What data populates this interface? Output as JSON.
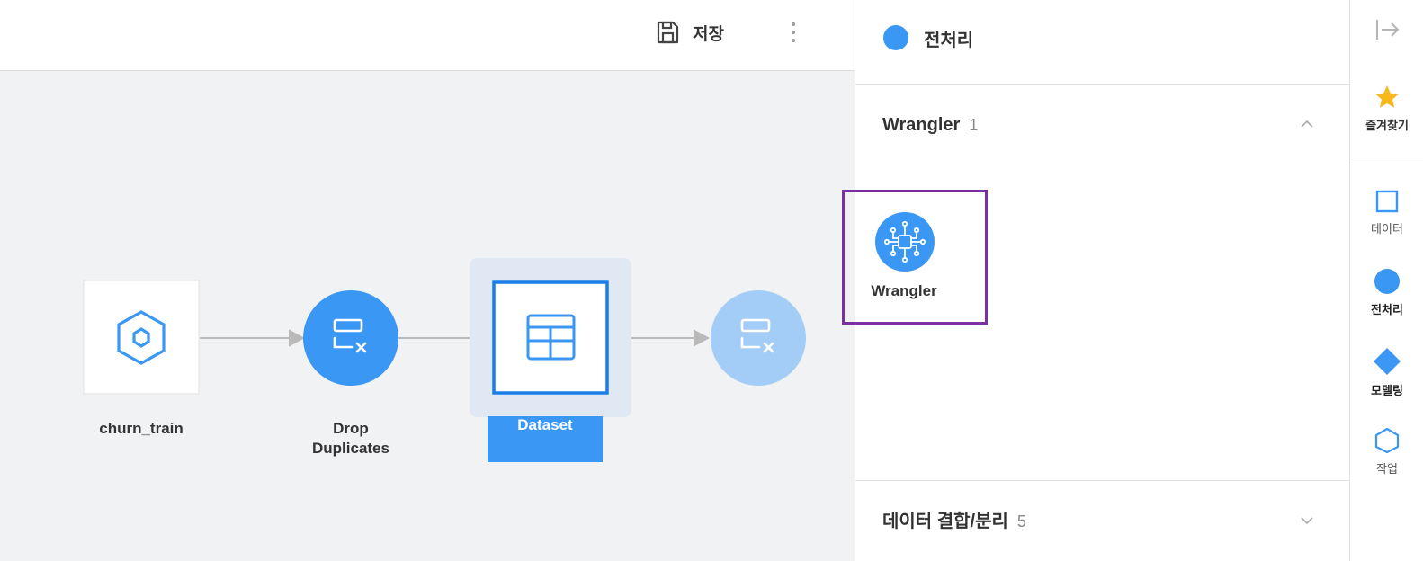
{
  "toolbar": {
    "save_label": "저장"
  },
  "workflow": {
    "nodes": [
      {
        "label": "churn_train",
        "icon": "hexagon-icon",
        "kind": "data"
      },
      {
        "label": "Drop\nDuplicates",
        "icon": "remove-duplicates-icon",
        "kind": "preprocess"
      },
      {
        "label": "Dataset",
        "icon": "table-icon",
        "kind": "dataset",
        "selected": true
      },
      {
        "label": "",
        "icon": "remove-duplicates-icon",
        "kind": "preprocess-ghost"
      }
    ],
    "node_labels": {
      "churn_train": "churn_train",
      "drop_line1": "Drop",
      "drop_line2": "Duplicates",
      "dataset": "Dataset"
    }
  },
  "panel": {
    "title": "전처리",
    "title_color": "#3a97f4",
    "sections": [
      {
        "name": "Wrangler",
        "count": "1",
        "expanded": true,
        "items": [
          {
            "label": "Wrangler",
            "icon": "wrangler-icon"
          }
        ]
      },
      {
        "name": "데이터 결합/분리",
        "count": "5",
        "expanded": false
      }
    ]
  },
  "sidebar": {
    "collapse_icon": "collapse-right-icon",
    "items": [
      {
        "label": "즐겨찾기",
        "icon": "star-icon",
        "color": "#f6b81c"
      },
      {
        "label": "데이터",
        "icon": "square-icon",
        "color": "#3a97f4"
      },
      {
        "label": "전처리",
        "icon": "circle-icon",
        "color": "#3a97f4",
        "active": true
      },
      {
        "label": "모델링",
        "icon": "diamond-icon",
        "color": "#3a97f4"
      },
      {
        "label": "작업",
        "icon": "hexagon-icon",
        "color": "#3a97f4"
      }
    ]
  },
  "colors": {
    "accent": "#3a97f4",
    "accent_light": "#a3cdf6",
    "highlight": "#7b2fa0",
    "canvas_bg": "#f1f2f4"
  }
}
